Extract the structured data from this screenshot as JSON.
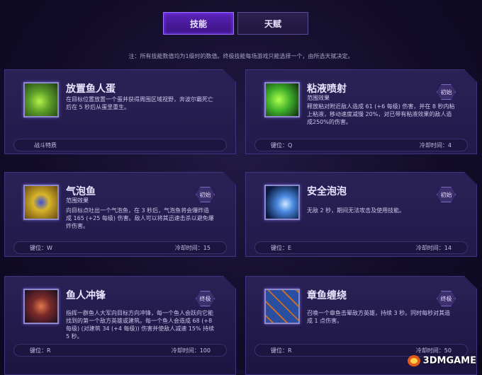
{
  "tabs": [
    {
      "label": "技能",
      "active": true
    },
    {
      "label": "天赋",
      "active": false
    }
  ],
  "note": "注：所有技能数值均为1级时的数值。终极技能每场游戏只能选择一个，由所选天赋决定。",
  "abilities": [
    {
      "name": "放置鱼人蛋",
      "subtitle": "",
      "badge": "",
      "description": "在目标位置放置一个蛋并获得周围区域视野，奔波尔霸死亡后在 5 秒后从蛋里重生。",
      "footer_left": "战斗特质",
      "footer_right": "",
      "icon": "murloc-egg-icon",
      "color": "#6cd03a"
    },
    {
      "name": "粘液喷射",
      "subtitle": "范围效果",
      "badge": "初始",
      "description": "释放粘对附近敌人造成 61 (+6 每级) 伤害，并在 8 秒内粘上粘液，移动速度减慢 20%，对已带有粘液效果的敌人造成250%的伤害。",
      "footer_left": "键位：Q",
      "footer_right": "冷却时间：4",
      "icon": "slime-icon",
      "color": "#6cd03a"
    },
    {
      "name": "气泡鱼",
      "subtitle": "范围效果",
      "badge": "初始",
      "description": "向目标点吐出一个气泡鱼，在 3 秒后，气泡鱼将会爆炸造成 165 (+25 每级) 伤害。敌人可以将其迅速击杀以避免爆炸伤害。",
      "footer_left": "键位：W",
      "footer_right": "冷却时间：15",
      "icon": "pufferfish-icon",
      "color": "#d8b52a"
    },
    {
      "name": "安全泡泡",
      "subtitle": "",
      "badge": "初始",
      "description": "无敌 2 秒，期间无法攻击及使用技能。",
      "footer_left": "键位：E",
      "footer_right": "冷却时间：14",
      "icon": "bubble-icon",
      "color": "#5aa0ff"
    },
    {
      "name": "鱼人冲锋",
      "subtitle": "",
      "badge": "终极",
      "description": "指挥一群鱼人大军向目标方向冲锋，每一个鱼人会跃向它能找到的第一个敌方英雄或建筑。每一个鱼人会造成 68 (+8 每级) (对建筑 34 (+4 每级)) 伤害并使敌人减速 15% 持续 5 秒。",
      "footer_left": "键位：R",
      "footer_right": "冷却时间：100",
      "icon": "murloc-charge-icon",
      "color": "#c85a3a"
    },
    {
      "name": "章鱼缠绕",
      "subtitle": "",
      "badge": "终极",
      "description": "召唤一个章鱼击晕敌方英雄，持续 3 秒。同时每秒对其造成 1 点伤害。",
      "footer_left": "键位：R",
      "footer_right": "冷却时间：50",
      "icon": "octopus-icon",
      "color": "#4a7ad8"
    }
  ],
  "watermark": "3DMGAME"
}
